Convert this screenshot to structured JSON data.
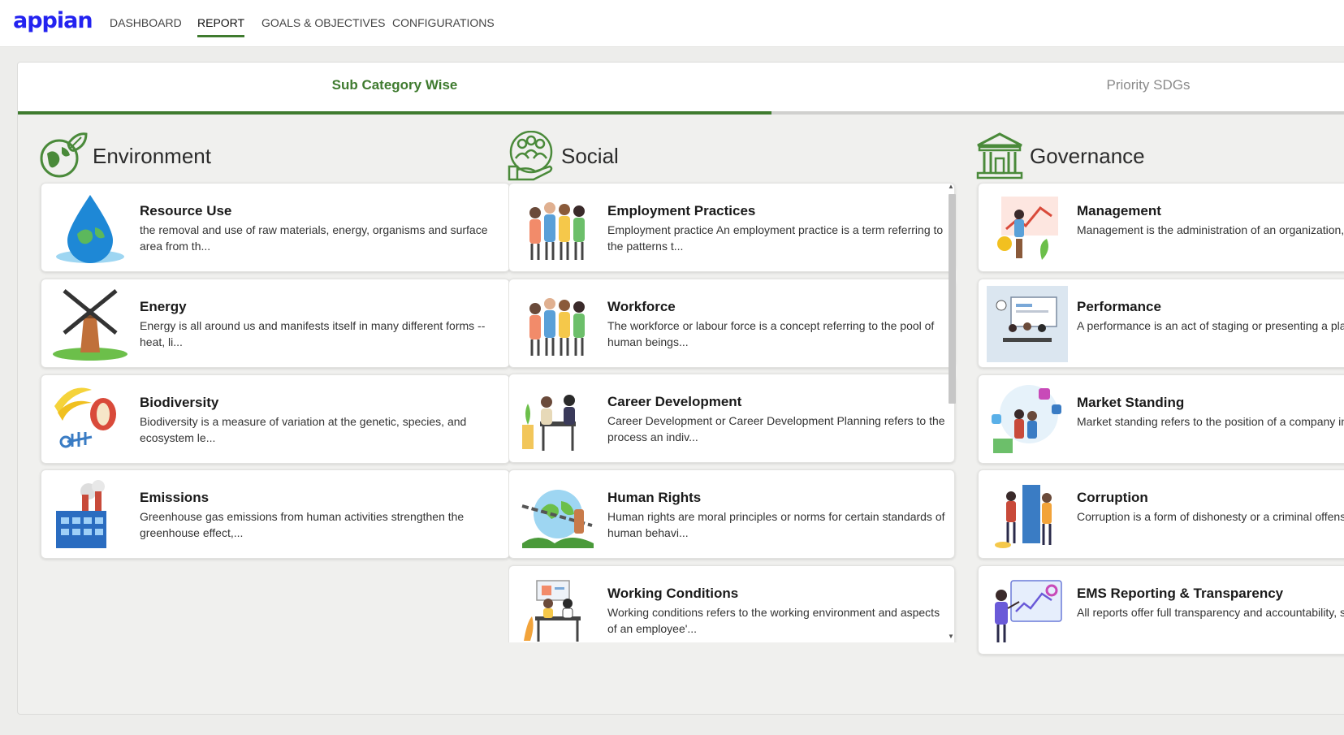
{
  "app": {
    "logo": "appian"
  },
  "nav": [
    {
      "label": "DASHBOARD"
    },
    {
      "label": "REPORT"
    },
    {
      "label": "GOALS & OBJECTIVES"
    },
    {
      "label": "CONFIGURATIONS"
    }
  ],
  "tabs": [
    {
      "label": "Sub Category Wise"
    },
    {
      "label": "Priority SDGs"
    }
  ],
  "colors": {
    "brand": "#2322f0",
    "accent": "#3f7b2f"
  },
  "categories": [
    {
      "title": "Environment",
      "icon": "globe-leaf-icon",
      "items": [
        {
          "title": "Resource Use",
          "desc": "the removal and use of raw materials, energy, organisms and surface area from th...",
          "icon": "water-drop-earth-icon"
        },
        {
          "title": "Energy",
          "desc": "Energy is all around us and manifests itself in many different forms -- heat, li...",
          "icon": "windmill-icon"
        },
        {
          "title": "Biodiversity",
          "desc": "Biodiversity is a measure of variation at the genetic, species, and ecosystem le...",
          "icon": "food-waste-icon"
        },
        {
          "title": "Emissions",
          "desc": "Greenhouse gas emissions from human activities strengthen the greenhouse effect,...",
          "icon": "factory-icon"
        }
      ]
    },
    {
      "title": "Social",
      "icon": "people-hand-icon",
      "items": [
        {
          "title": "Employment Practices",
          "desc": "Employment practice An employment practice is a term referring to the patterns t...",
          "icon": "group-people-icon"
        },
        {
          "title": "Workforce",
          "desc": "The workforce or labour force is a concept referring to the pool of human beings...",
          "icon": "group-people-icon"
        },
        {
          "title": "Career Development",
          "desc": "Career Development or Career Development Planning refers to the process an indiv...",
          "icon": "interview-desk-icon"
        },
        {
          "title": "Human Rights",
          "desc": "Human rights are moral principles or norms for certain standards of human behavi...",
          "icon": "chained-globe-icon"
        },
        {
          "title": "Working Conditions",
          "desc": "Working conditions refers to the working environment and aspects of an employee'...",
          "icon": "office-meeting-icon"
        }
      ]
    },
    {
      "title": "Governance",
      "icon": "bank-building-icon",
      "items": [
        {
          "title": "Management",
          "desc": "Management is the administration of an organization, whether it is a business, a...",
          "icon": "growth-chart-icon"
        },
        {
          "title": "Performance",
          "desc": "A performance is an act of staging or presenting a play, concert, or other form ...",
          "icon": "presentation-board-icon"
        },
        {
          "title": "Market Standing",
          "desc": "Market standing refers to the position of a company in comparison to its compe...",
          "icon": "social-media-icon"
        },
        {
          "title": "Corruption",
          "desc": "Corruption is a form of dishonesty or a criminal offense which is undertaken by ...",
          "icon": "bribe-door-icon"
        },
        {
          "title": "EMS Reporting & Transparency",
          "desc": "All reports offer full transparency and accountability, showing again how yo...",
          "icon": "report-dashboard-icon"
        }
      ]
    }
  ]
}
